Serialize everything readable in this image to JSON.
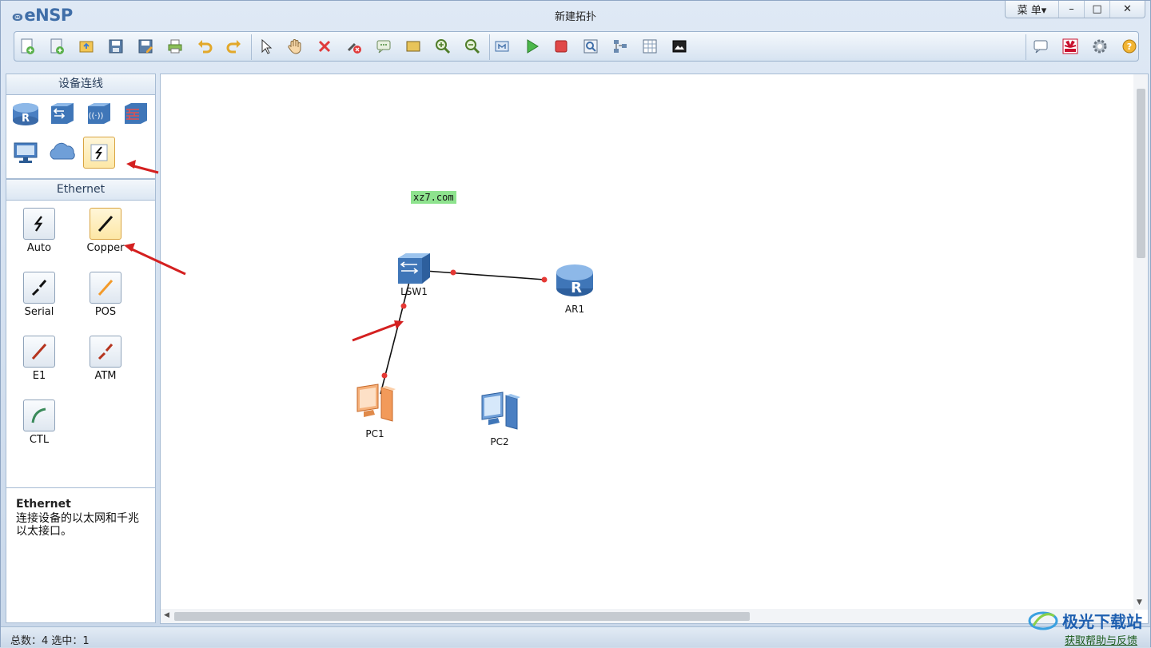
{
  "app": {
    "name": "eNSP",
    "window_title": "新建拓扑"
  },
  "window_controls": {
    "menu": "菜 单▾",
    "minimize": "–",
    "maximize": "□",
    "close": "✕"
  },
  "toolbar": {
    "buttons": [
      "new-topology",
      "new-example",
      "open",
      "save",
      "save-as",
      "print",
      "undo",
      "redo",
      "select",
      "pan",
      "delete",
      "delete-link",
      "text-note",
      "rectangle",
      "zoom-in",
      "zoom-out",
      "fit",
      "start-all",
      "stop-all",
      "capture",
      "topology-view",
      "grid",
      "screenshot"
    ],
    "right_buttons": [
      "chat",
      "huawei",
      "settings",
      "help"
    ]
  },
  "left_panel": {
    "devices_header": "设备连线",
    "devices": [
      "router-icon",
      "switch-icon",
      "wireless-icon",
      "firewall-icon",
      "pc-icon",
      "cloud-icon",
      "connection-icon"
    ],
    "cables_header": "Ethernet",
    "cables": [
      {
        "label": "Auto"
      },
      {
        "label": "Copper"
      },
      {
        "label": "Serial"
      },
      {
        "label": "POS"
      },
      {
        "label": "E1"
      },
      {
        "label": "ATM"
      },
      {
        "label": "CTL"
      }
    ],
    "info_title": "Ethernet",
    "info_text": "连接设备的以太网和千兆以太接口。"
  },
  "canvas": {
    "tag": "xz7.com",
    "nodes": [
      {
        "name": "LSW1"
      },
      {
        "name": "AR1"
      },
      {
        "name": "PC1"
      },
      {
        "name": "PC2"
      }
    ]
  },
  "status": {
    "text": "总数：4  选中：1",
    "help_link": "获取帮助与反馈"
  },
  "brand_watermark": "极光下载站",
  "colors": {
    "accent": "#3f6ea8",
    "selected": "#fde7a6",
    "link_dot": "#e53935",
    "arrow": "#d42020"
  }
}
